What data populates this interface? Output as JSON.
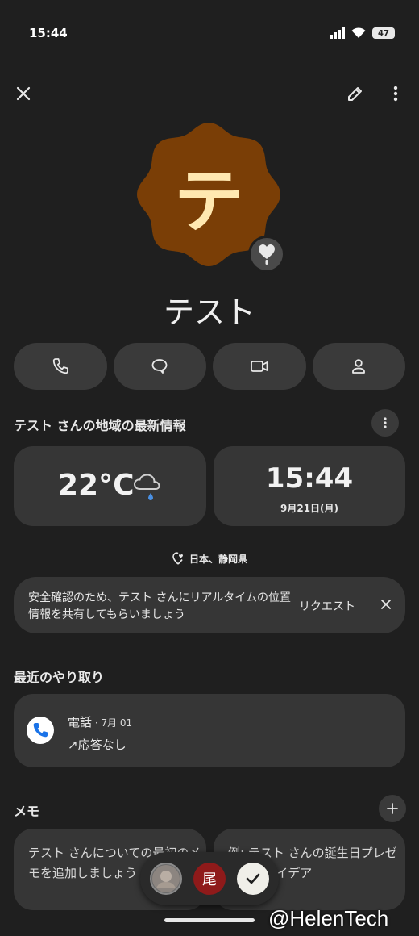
{
  "status": {
    "time": "15:44",
    "battery": "47"
  },
  "contact": {
    "initial": "テ",
    "name": "テスト"
  },
  "local_info": {
    "title": "テスト さんの地域の最新情報",
    "temperature": "22°C",
    "time": "15:44",
    "date": "9月21日(月)",
    "location": "日本、静岡県"
  },
  "location_banner": {
    "text": "安全確認のため、テスト さんにリアルタイムの位置情報を共有してもらいましょう",
    "action": "リクエスト"
  },
  "recent": {
    "title": "最近のやり取り",
    "call_type": "電話",
    "call_date": " · 7月 01",
    "call_status": "↗応答なし"
  },
  "memo": {
    "title": "メモ",
    "card1": "テスト さんについての最初のメモを追加しましょう",
    "card2": "例: テスト さんの誕生日プレゼントのアイデア"
  },
  "float_bar": {
    "middle_label": "尾"
  },
  "watermark": "@HelenTech",
  "colors": {
    "avatar": "#7a3e06",
    "accent": "#1a73e8",
    "background": "#1f1f1f",
    "card": "#363636"
  },
  "icons": [
    "close-icon",
    "edit-pencil-icon",
    "more-vert-icon",
    "heart-icon",
    "phone-icon",
    "message-icon",
    "video-icon",
    "person-icon",
    "cloud-rain-icon",
    "location-heart-icon",
    "plus-icon",
    "check-icon"
  ]
}
